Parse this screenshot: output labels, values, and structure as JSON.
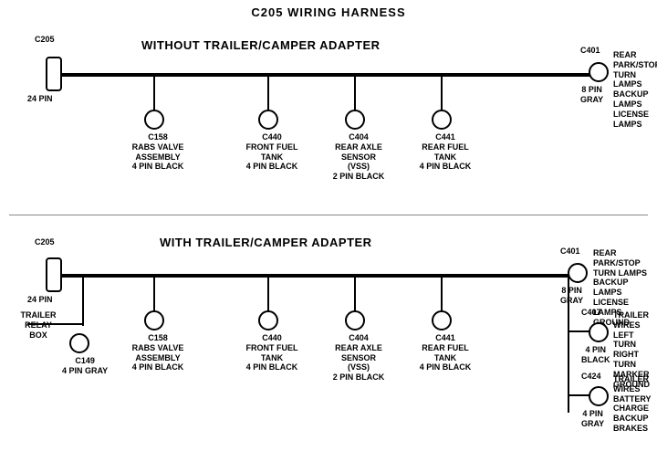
{
  "title": "C205 WIRING HARNESS",
  "top_section": {
    "label": "WITHOUT TRAILER/CAMPER ADAPTER",
    "left_connector": {
      "id": "C205",
      "pin_label": "24 PIN"
    },
    "right_connector": {
      "id": "C401",
      "pin_label": "8 PIN\nGRAY",
      "desc": "REAR PARK/STOP\nTURN LAMPS\nBACKUP LAMPS\nLICENSE LAMPS"
    },
    "connectors": [
      {
        "id": "C158",
        "desc": "RABS VALVE\nASSEMBLY\n4 PIN BLACK"
      },
      {
        "id": "C440",
        "desc": "FRONT FUEL\nTANK\n4 PIN BLACK"
      },
      {
        "id": "C404",
        "desc": "REAR AXLE\nSENSOR\n(VSS)\n2 PIN BLACK"
      },
      {
        "id": "C441",
        "desc": "REAR FUEL\nTANK\n4 PIN BLACK"
      }
    ]
  },
  "bottom_section": {
    "label": "WITH TRAILER/CAMPER ADAPTER",
    "left_connector": {
      "id": "C205",
      "pin_label": "24 PIN"
    },
    "right_connector": {
      "id": "C401",
      "pin_label": "8 PIN\nGRAY",
      "desc": "REAR PARK/STOP\nTURN LAMPS\nBACKUP LAMPS\nLICENSE LAMPS\nGROUND"
    },
    "extra_left": {
      "label": "TRAILER\nRELAY\nBOX",
      "id": "C149",
      "pin_label": "4 PIN GRAY"
    },
    "connectors": [
      {
        "id": "C158",
        "desc": "RABS VALVE\nASSEMBLY\n4 PIN BLACK"
      },
      {
        "id": "C440",
        "desc": "FRONT FUEL\nTANK\n4 PIN BLACK"
      },
      {
        "id": "C404",
        "desc": "REAR AXLE\nSENSOR\n(VSS)\n2 PIN BLACK"
      },
      {
        "id": "C441",
        "desc": "REAR FUEL\nTANK\n4 PIN BLACK"
      }
    ],
    "right_extra": [
      {
        "id": "C407",
        "pin_label": "4 PIN\nBLACK",
        "desc": "TRAILER WIRES\nLEFT TURN\nRIGHT TURN\nMARKER\nGROUND"
      },
      {
        "id": "C424",
        "pin_label": "4 PIN\nGRAY",
        "desc": "TRAILER WIRES\nBATTERY CHARGE\nBACKUP\nBRAKES"
      }
    ]
  }
}
